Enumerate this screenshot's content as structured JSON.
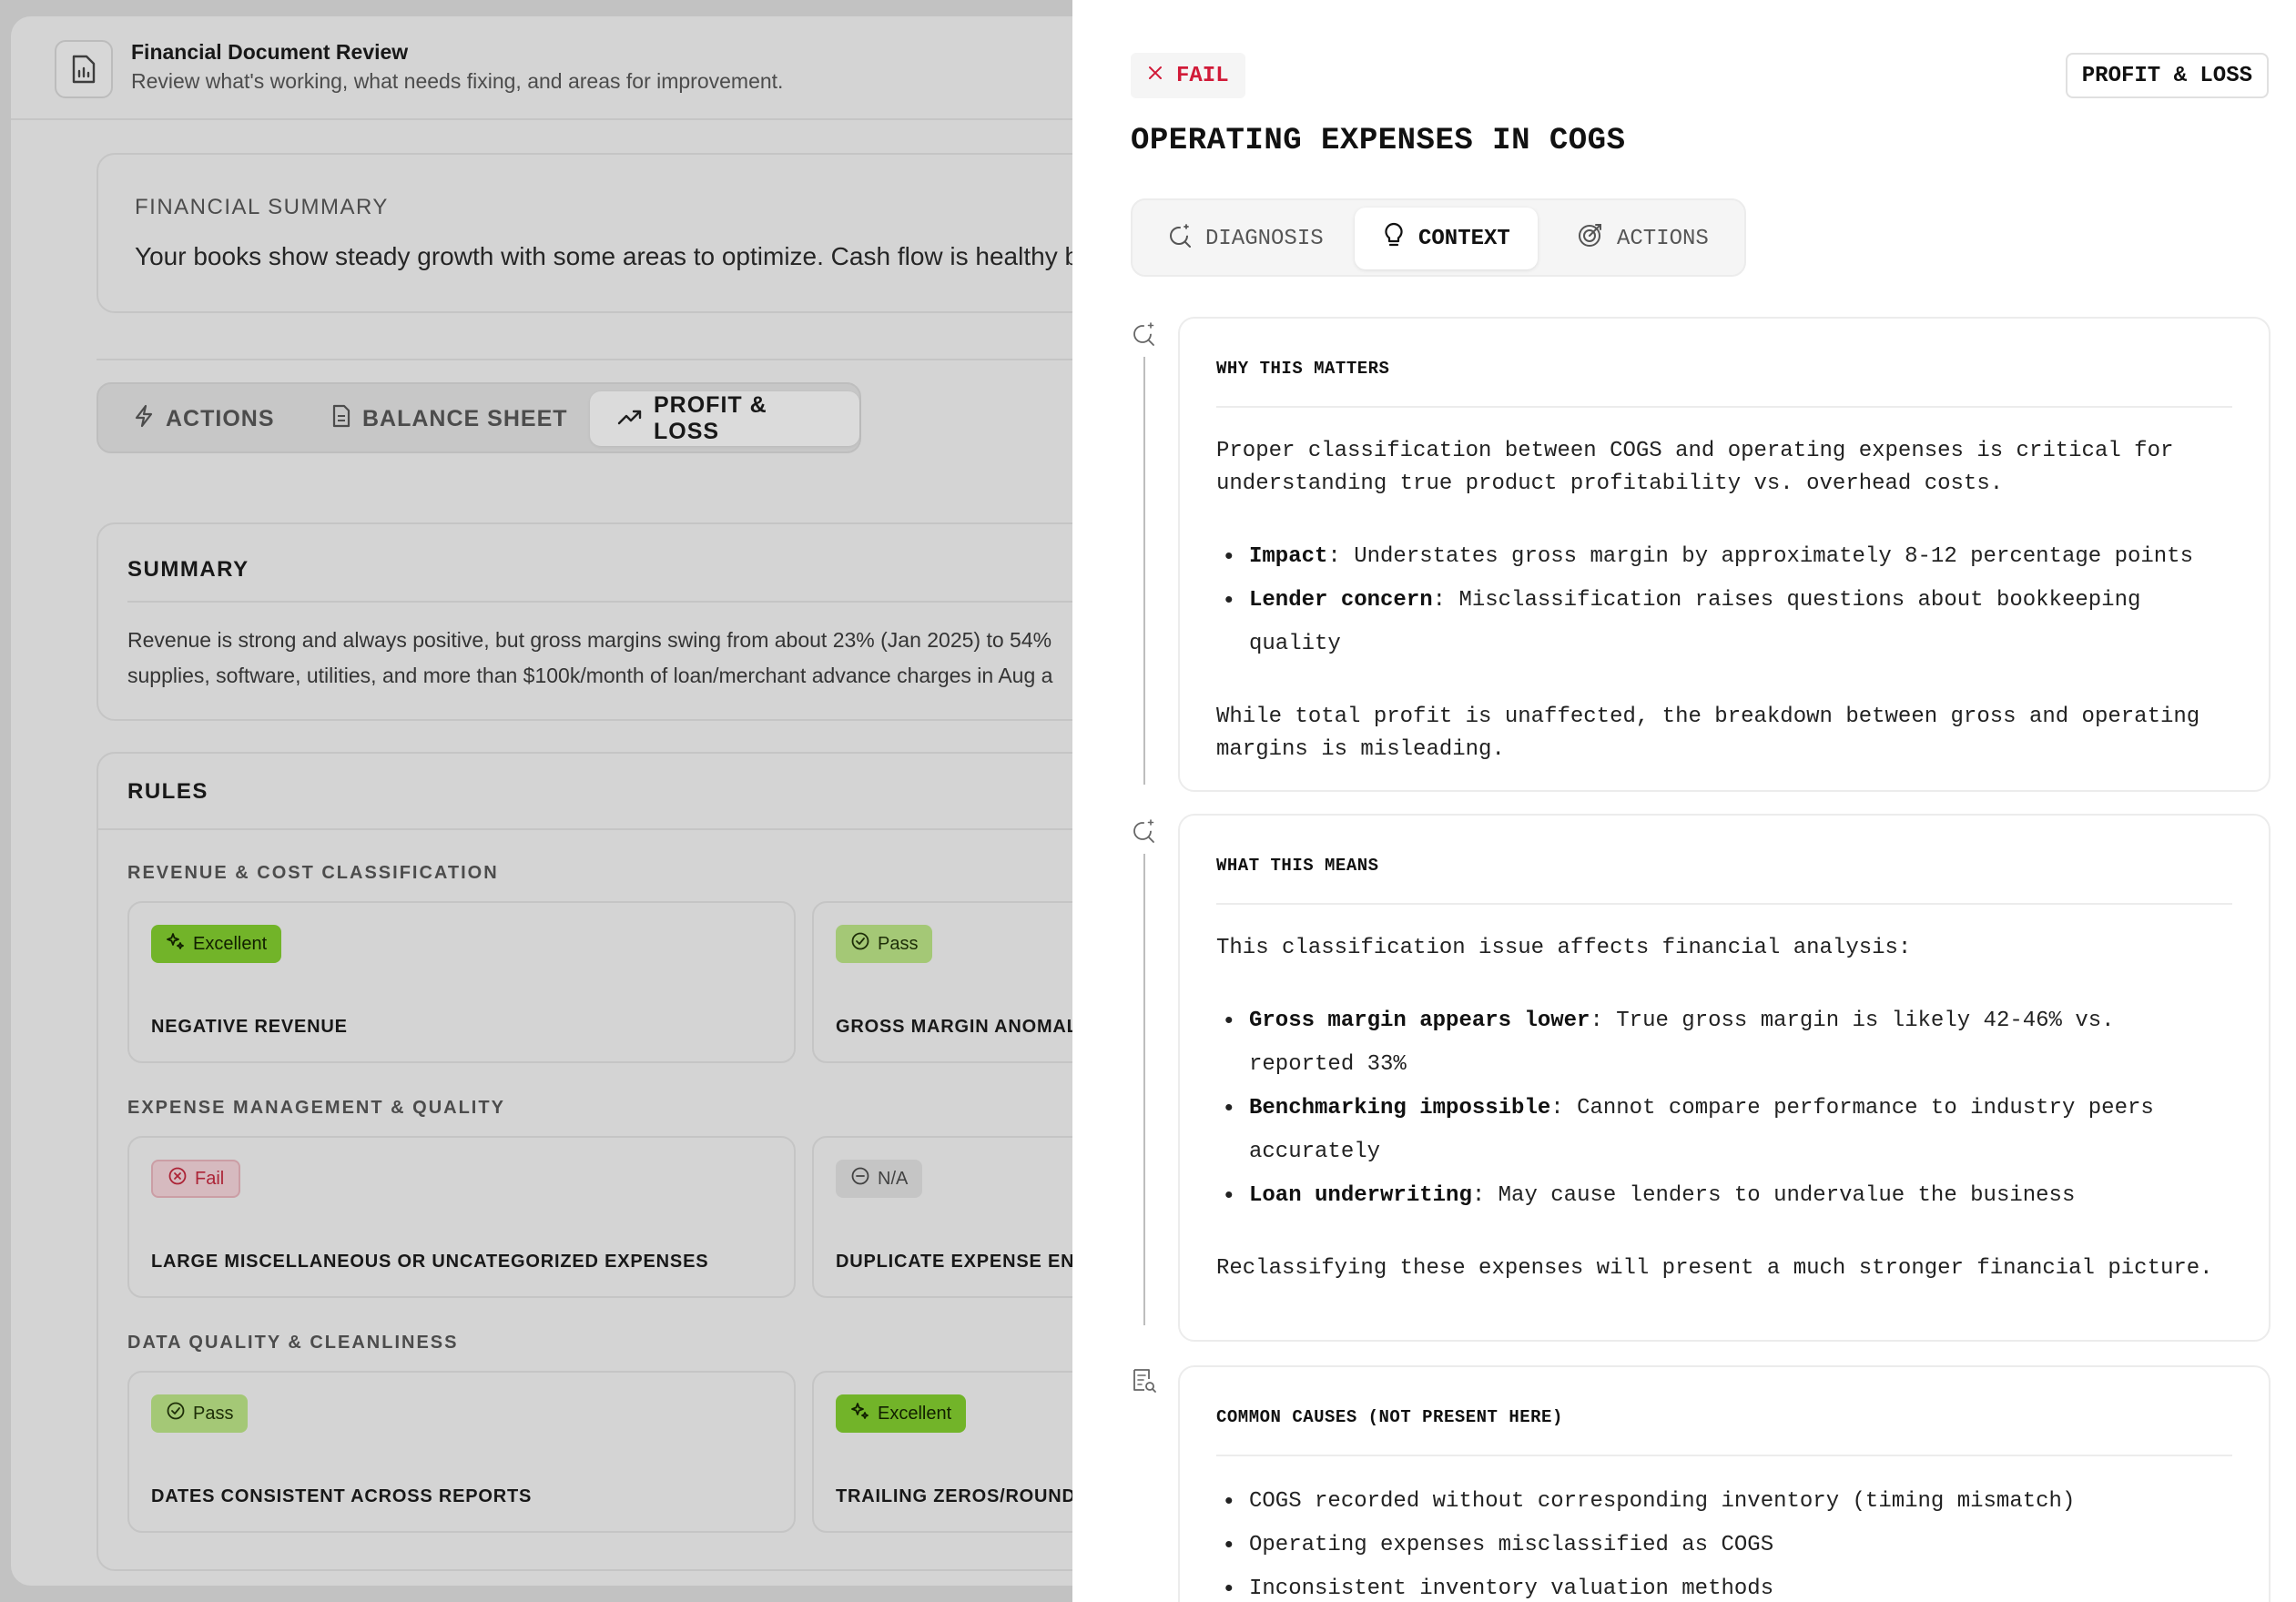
{
  "background": {
    "header": {
      "title": "Financial Document Review",
      "subtitle": "Review what's working, what needs fixing, and areas for improvement."
    },
    "financial_summary": {
      "label": "FINANCIAL SUMMARY",
      "text": "Your books show steady growth with some areas to optimize. Cash flow is healthy bu"
    },
    "tabs": [
      {
        "label": "ACTIONS",
        "icon": "bolt-icon"
      },
      {
        "label": "BALANCE SHEET",
        "icon": "document-icon"
      },
      {
        "label": "PROFIT & LOSS",
        "icon": "trend-up-icon",
        "active": true
      }
    ],
    "summary": {
      "heading": "SUMMARY",
      "line1": "Revenue is strong and always positive, but gross margins swing from about 23% (Jan 2025) to 54%",
      "line2": "supplies, software, utilities, and more than $100k/month of loan/merchant advance charges in Aug a"
    },
    "rules": {
      "heading": "RULES",
      "sections": [
        {
          "label": "REVENUE & COST CLASSIFICATION",
          "items": [
            {
              "badge": "Excellent",
              "status": "excellent",
              "name": "NEGATIVE REVENUE"
            },
            {
              "badge": "Pass",
              "status": "pass",
              "name": "GROSS MARGIN ANOMAL"
            }
          ]
        },
        {
          "label": "EXPENSE MANAGEMENT & QUALITY",
          "items": [
            {
              "badge": "Fail",
              "status": "fail",
              "name": "LARGE MISCELLANEOUS OR UNCATEGORIZED EXPENSES"
            },
            {
              "badge": "N/A",
              "status": "na",
              "name": "DUPLICATE EXPENSE ENT"
            }
          ]
        },
        {
          "label": "DATA QUALITY & CLEANLINESS",
          "items": [
            {
              "badge": "Pass",
              "status": "pass",
              "name": "DATES CONSISTENT ACROSS REPORTS"
            },
            {
              "badge": "Excellent",
              "status": "excellent",
              "name": "TRAILING ZEROS/ROUND"
            }
          ]
        }
      ]
    }
  },
  "drawer": {
    "status": "FAIL",
    "category": "PROFIT & LOSS",
    "title": "OPERATING EXPENSES IN COGS",
    "tabs": [
      {
        "label": "DIAGNOSIS",
        "icon": "diagnosis-icon"
      },
      {
        "label": "CONTEXT",
        "icon": "lightbulb-icon",
        "active": true
      },
      {
        "label": "ACTIONS",
        "icon": "target-icon"
      }
    ],
    "panels": [
      {
        "heading": "WHY THIS MATTERS",
        "intro": "Proper classification between COGS and operating expenses is critical for understanding true product profitability vs. overhead costs.",
        "bullets": [
          {
            "term": "Impact",
            "text": ": Understates gross margin by approximately 8-12 percentage points"
          },
          {
            "term": "Lender concern",
            "text": ": Misclassification raises questions about bookkeeping quality"
          }
        ],
        "outro": "While total profit is unaffected, the breakdown between gross and operating margins is misleading."
      },
      {
        "heading": "WHAT THIS MEANS",
        "intro": "This classification issue affects financial analysis:",
        "bullets": [
          {
            "term": "Gross margin appears lower",
            "text": ": True gross margin is likely 42-46% vs. reported 33%"
          },
          {
            "term": "Benchmarking impossible",
            "text": ": Cannot compare performance to industry peers accurately"
          },
          {
            "term": "Loan underwriting",
            "text": ": May cause lenders to undervalue the business"
          }
        ],
        "outro": "Reclassifying these expenses will present a much stronger financial picture."
      },
      {
        "heading": "COMMON CAUSES (NOT PRESENT HERE)",
        "bullets": [
          {
            "text": "COGS recorded without corresponding inventory (timing mismatch)"
          },
          {
            "text": "Operating expenses misclassified as COGS"
          },
          {
            "text": "Inconsistent inventory valuation methods"
          }
        ]
      }
    ]
  }
}
